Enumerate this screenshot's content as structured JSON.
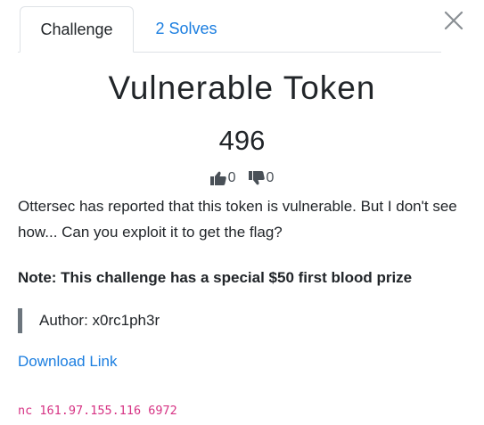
{
  "tabs": {
    "challenge_label": "Challenge",
    "solves_label": "2 Solves"
  },
  "challenge": {
    "name": "Vulnerable Token",
    "points": "496",
    "upvotes": "0",
    "downvotes": "0",
    "description": "Ottersec has reported that this token is vulnerable. But I don't see how... Can you exploit it to get the flag?",
    "note": "Note: This challenge has a special $50 first blood prize",
    "author": "Author: x0rc1ph3r",
    "download_label": "Download Link",
    "connection": "nc 161.97.155.116 6972"
  },
  "icons": {
    "close": "close-icon",
    "upvote": "thumbs-up-icon",
    "downvote": "thumbs-down-icon"
  },
  "colors": {
    "link": "#1b7ee0",
    "code": "#d63384",
    "quote_border": "#6c757d"
  }
}
